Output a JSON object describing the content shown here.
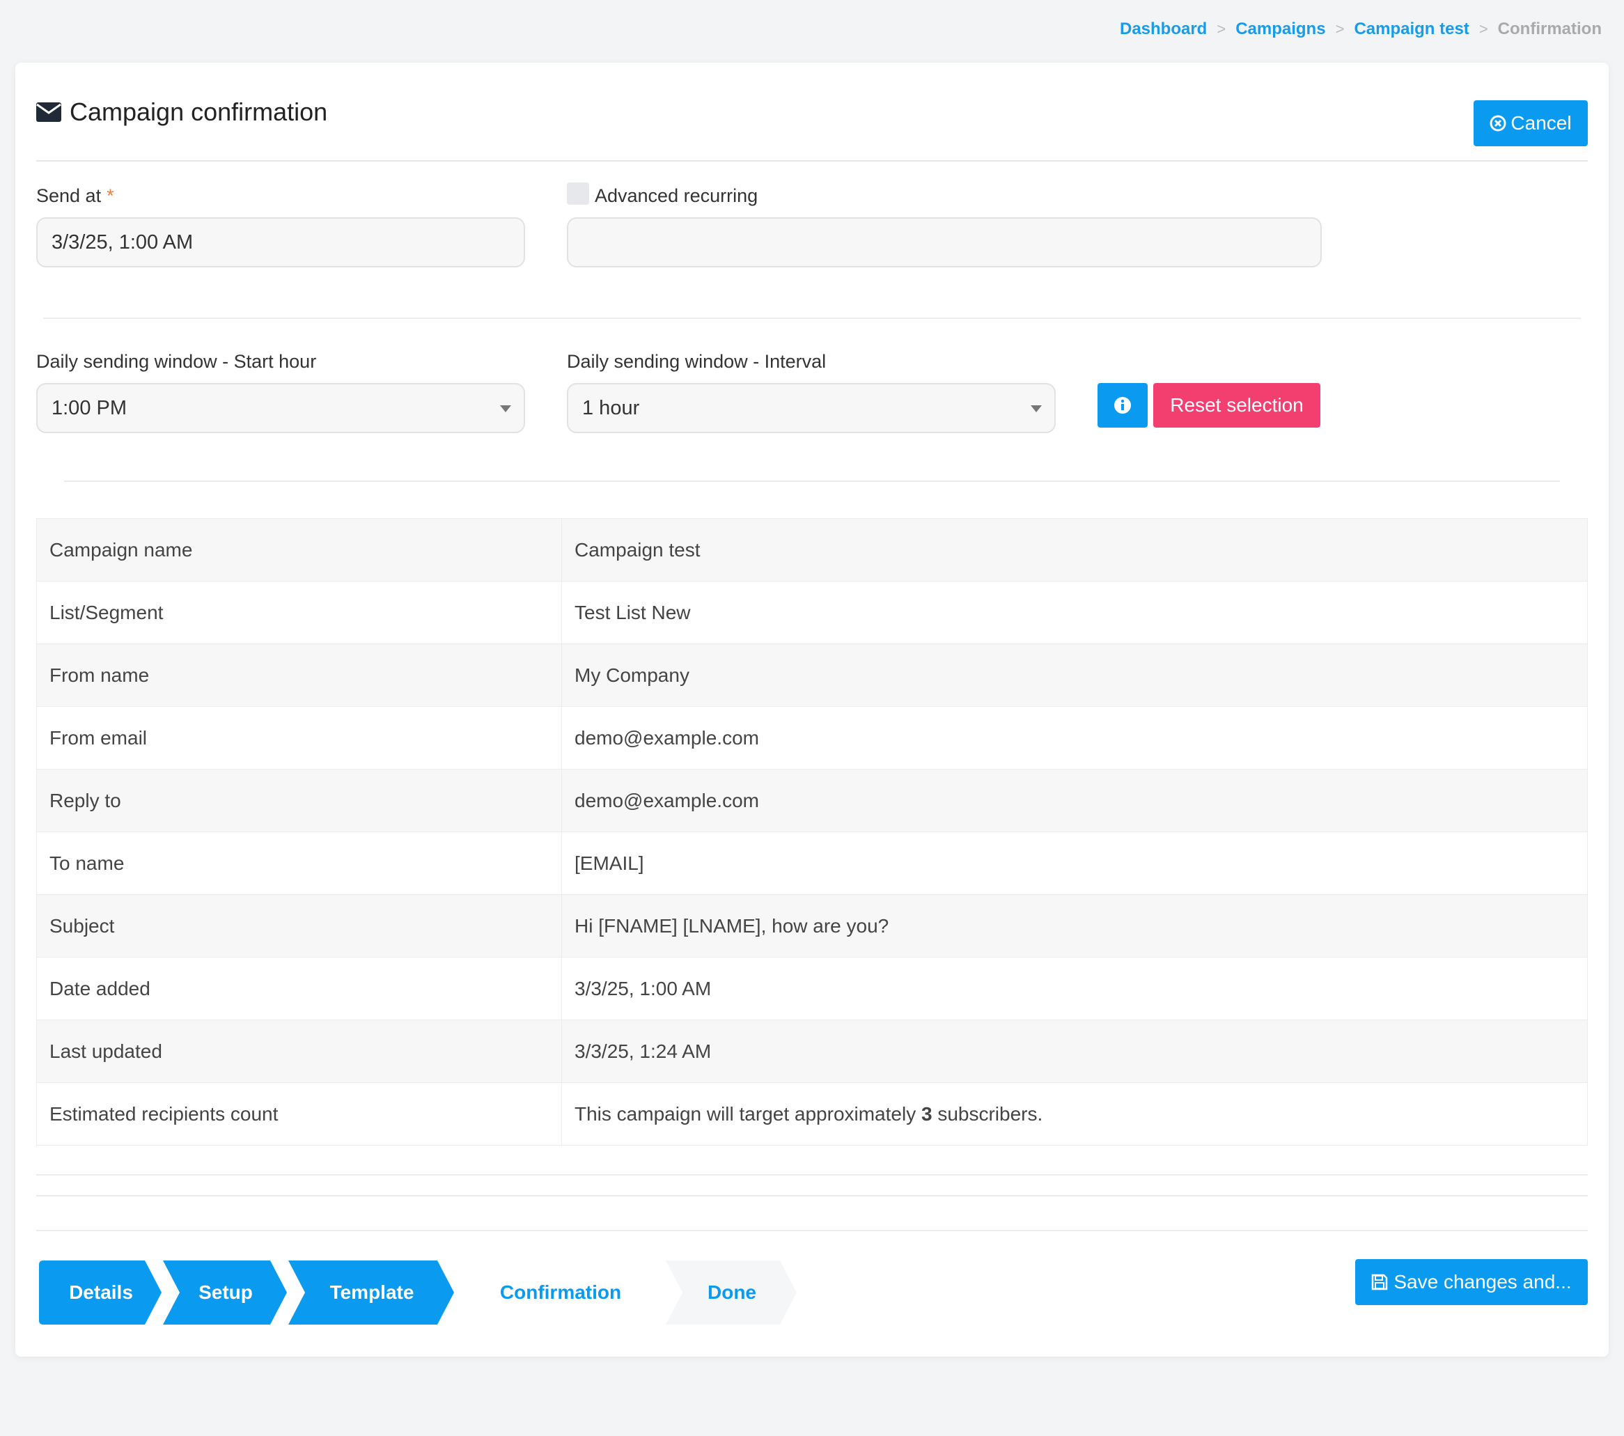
{
  "breadcrumb": {
    "items": [
      "Dashboard",
      "Campaigns",
      "Campaign test"
    ],
    "current": "Confirmation",
    "separator": ">"
  },
  "header": {
    "title": "Campaign confirmation",
    "cancel_label": "Cancel"
  },
  "form": {
    "send_at_label": "Send at",
    "required_mark": "*",
    "send_at_value": "3/3/25, 1:00 AM",
    "advanced_recurring_label": "Advanced recurring",
    "advanced_recurring_value": "",
    "start_hour_label": "Daily sending window - Start hour",
    "start_hour_value": "1:00 PM",
    "interval_label": "Daily sending window - Interval",
    "interval_value": "1 hour",
    "reset_label": "Reset selection"
  },
  "details": {
    "rows": [
      {
        "label": "Campaign name",
        "value": "Campaign test"
      },
      {
        "label": "List/Segment",
        "value": "Test List New"
      },
      {
        "label": "From name",
        "value": "My Company"
      },
      {
        "label": "From email",
        "value": "demo@example.com"
      },
      {
        "label": "Reply to",
        "value": "demo@example.com"
      },
      {
        "label": "To name",
        "value": "[EMAIL]"
      },
      {
        "label": "Subject",
        "value": "Hi [FNAME] [LNAME], how are you?"
      },
      {
        "label": "Date added",
        "value": "3/3/25, 1:00 AM"
      },
      {
        "label": "Last updated",
        "value": "3/3/25, 1:24 AM"
      }
    ],
    "recipients_label": "Estimated recipients count",
    "recipients_prefix": "This campaign will target approximately ",
    "recipients_count": "3",
    "recipients_suffix": " subscribers."
  },
  "wizard": {
    "steps": [
      {
        "label": "Details",
        "state": "active"
      },
      {
        "label": "Setup",
        "state": "active"
      },
      {
        "label": "Template",
        "state": "active"
      },
      {
        "label": "Confirmation",
        "state": "current"
      },
      {
        "label": "Done",
        "state": "upcoming"
      }
    ]
  },
  "footer": {
    "save_label": "Save changes and..."
  },
  "colors": {
    "primary": "#0a9bf0",
    "danger": "#f33f6f",
    "link": "#1a9be8",
    "required": "#f27d3a"
  },
  "icons": {
    "title": "envelope-icon",
    "cancel": "times-circle-icon",
    "info": "info-circle-icon",
    "save": "floppy-disk-icon"
  }
}
